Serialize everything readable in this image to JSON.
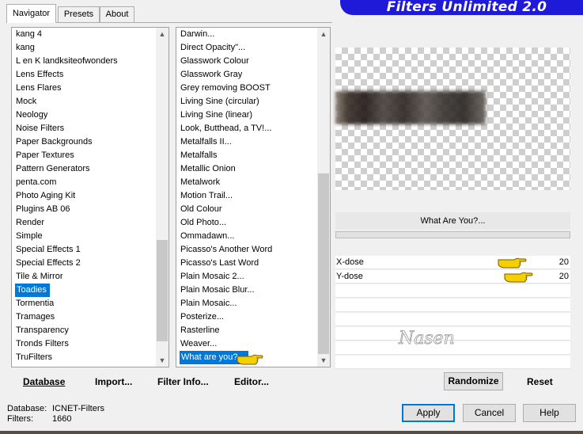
{
  "tabs": [
    "Navigator",
    "Presets",
    "About"
  ],
  "brand_title": "Filters Unlimited 2.0",
  "categories": [
    "kang 4",
    "kang",
    "L en K landksiteofwonders",
    "Lens Effects",
    "Lens Flares",
    "Mock",
    "Neology",
    "Noise Filters",
    "Paper Backgrounds",
    "Paper Textures",
    "Pattern Generators",
    "penta.com",
    "Photo Aging Kit",
    "Plugins AB 06",
    "Render",
    "Simple",
    "Special Effects 1",
    "Special Effects 2",
    "Tile & Mirror",
    "Toadies",
    "Tormentia",
    "Tramages",
    "Transparency",
    "Tronds Filters",
    "TruFilters"
  ],
  "categories_selected": "Toadies",
  "filters": [
    "Darwin...",
    "Direct Opacity\"...",
    "Glasswork Colour",
    "Glasswork Gray",
    "Grey removing BOOST",
    "Living Sine (circular)",
    "Living Sine (linear)",
    "Look, Butthead, a TV!...",
    "Metalfalls II...",
    "Metalfalls",
    "Metallic Onion",
    "Metalwork",
    "Motion Trail...",
    "Old Colour",
    "Old Photo...",
    "Ommadawn...",
    "Picasso's Another Word",
    "Picasso's Last Word",
    "Plain Mosaic 2...",
    "Plain Mosaic Blur...",
    "Plain Mosaic...",
    "Posterize...",
    "Rasterline",
    "Weaver...",
    "What are you?..."
  ],
  "filters_selected": "What are you?...",
  "params": {
    "title": "What Are You?...",
    "rows": [
      {
        "label": "X-dose",
        "value": "20"
      },
      {
        "label": "Y-dose",
        "value": "20"
      }
    ]
  },
  "watermark": "Nasen",
  "left_buttons": {
    "database": "Database",
    "import": "Import...",
    "filter_info": "Filter Info...",
    "editor": "Editor..."
  },
  "right_buttons": {
    "randomize": "Randomize",
    "reset": "Reset"
  },
  "footer": {
    "database_label": "Database:",
    "database_value": "ICNET-Filters",
    "filters_label": "Filters:",
    "filters_value": "1660"
  },
  "dialog_buttons": {
    "apply": "Apply",
    "cancel": "Cancel",
    "help": "Help"
  },
  "colors": {
    "selection": "#0078d7",
    "brand_bg": "#1f1ad8",
    "pointer_hand": "#f5d000"
  },
  "icons": [
    "scroll-up-icon",
    "scroll-down-icon",
    "pointing-hand-icon"
  ]
}
